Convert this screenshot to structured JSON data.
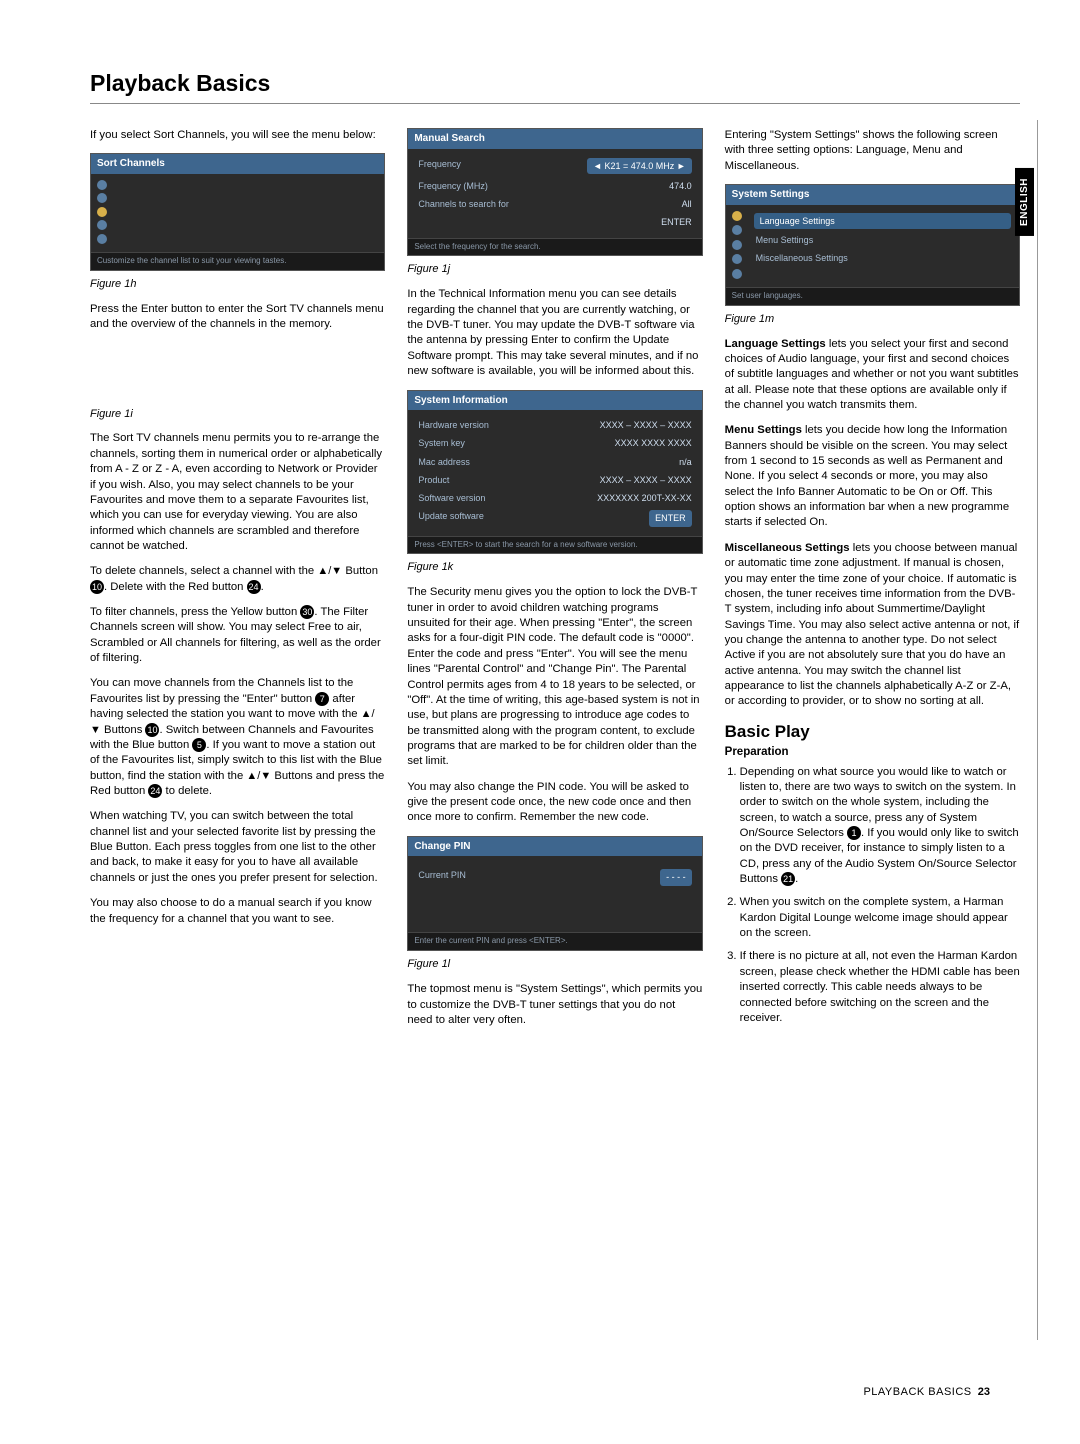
{
  "page": {
    "title": "Playback Basics",
    "english_tab": "ENGLISH",
    "footer_label": "PLAYBACK BASICS",
    "footer_page": "23"
  },
  "col1": {
    "intro": "If you select Sort Channels, you will see the menu below:",
    "shot_sort": {
      "hdr": "Sort Channels",
      "tip": "Customize the channel list to suit your viewing tastes."
    },
    "fig1h": "Figure 1h",
    "p_after_1h": "Press the Enter button to enter the Sort TV channels menu and the overview of the channels in the memory.",
    "fig1i": "Figure 1i",
    "p1i_1": "The Sort TV channels menu permits you to re-arrange the channels, sorting them in numerical order or alphabetically from A - Z or Z - A, even according to Network or Provider if you wish. Also, you may select channels to be your Favourites and move them to a separate Favourites list, which you can use for everyday viewing. You are also informed which channels are scrambled and therefore cannot be watched.",
    "p1i_2a": "To delete channels, select a channel with the ",
    "p1i_2b": "Button ",
    "p1i_2c": ". Delete with the Red button ",
    "p1i_2d": ".",
    "p1i_3a": "To filter channels, press the Yellow button ",
    "p1i_3b": ". The Filter Channels screen will show. You may select Free to air, Scrambled or All channels for filtering, as well as the order of filtering.",
    "p1i_4a": "You can move channels from the Channels list to the Favourites list by pressing the \"Enter\" button ",
    "p1i_4b": " after having selected the station you want to move with the ",
    "p1i_4c": " Buttons ",
    "p1i_4d": ". Switch between Channels and Favourites with the Blue button ",
    "p1i_4e": ". If you want to move a station out of the Favourites list, simply switch to this list with the Blue button, find the station with the ",
    "p1i_4f": " Buttons and press the Red button ",
    "p1i_4g": " to delete.",
    "p1i_5": "When watching TV, you can switch between the total channel list and your selected favorite list by pressing the Blue Button. Each press toggles from one list to the other and back, to make it easy for you to have all available channels or just the ones you prefer present for selection.",
    "p1i_6": "You may also choose to do a manual search if you know the frequency for a channel that you want to see.",
    "callouts": {
      "c10": "10",
      "c24": "24",
      "c30": "30",
      "c7": "7",
      "c5": "5"
    },
    "arrows": "▲/▼"
  },
  "col2": {
    "shot_manual": {
      "hdr": "Manual Search",
      "r1_l": "Frequency",
      "r1_v": "K21 = 474.0 MHz",
      "r2_l": "Frequency (MHz)",
      "r2_v": "474.0",
      "r3_l": "Channels to search for",
      "r3_v": "All",
      "r4_v": "ENTER",
      "tip": "Select the frequency for the search."
    },
    "fig1j": "Figure 1j",
    "p1j": "In the Technical Information menu you can see details regarding the channel that you are currently watching, or the DVB-T tuner. You may update the DVB-T software via the antenna by pressing Enter to confirm the Update Software prompt. This may take several minutes, and if no new software is available, you will be informed about this.",
    "shot_sys": {
      "hdr": "System Information",
      "r1_l": "Hardware version",
      "r1_v": "XXXX – XXXX – XXXX",
      "r2_l": "System key",
      "r2_v": "XXXX    XXXX  XXXX",
      "r3_l": "Mac address",
      "r3_v": "n/a",
      "r4_l": "Product",
      "r4_v": "XXXX – XXXX – XXXX",
      "r5_l": "Software version",
      "r5_v": "XXXXXXX 200T-XX-XX",
      "r6_l": "Update software",
      "r6_v": "ENTER",
      "tip": "Press <ENTER> to start the search for a new software version."
    },
    "fig1k": "Figure 1k",
    "p1k": "The Security menu gives you the option to lock the DVB-T tuner in order to avoid children watching programs unsuited for their age. When pressing \"Enter\", the screen asks for a four-digit PIN code. The default code is \"0000\". Enter the code and press \"Enter\". You will see the menu lines \"Parental Control\" and \"Change Pin\". The Parental Control permits ages from 4 to 18 years to be selected, or \"Off\". At the time of writing, this age-based system is not in use, but plans are progressing to introduce age codes to be transmitted along with the program content, to exclude programs that are marked to be for children older than the set limit.",
    "p1k2": "You may also change the PIN code. You will be asked to give the present code once, the new code once and then once more to confirm. Remember the new code.",
    "shot_pin": {
      "hdr": "Change PIN",
      "label": "Current PIN",
      "val": "- - - -",
      "tip": "Enter the current PIN and press <ENTER>."
    },
    "fig1l": "Figure 1l",
    "p1l": "The topmost menu is \"System Settings\", which permits you to customize the DVB-T tuner settings that you do not need to alter very often."
  },
  "col3": {
    "p_top": "Entering \"System Settings\" shows the following screen with three setting options: Language, Menu and Miscellaneous.",
    "shot_settings": {
      "hdr": "System Settings",
      "i1": "Language Settings",
      "i2": "Menu Settings",
      "i3": "Miscellaneous Settings",
      "tip": "Set user languages."
    },
    "fig1m": "Figure 1m",
    "lang_lead": "Language Settings",
    "lang_body": " lets you select your first and second choices of Audio language, your first and second choices of subtitle languages and whether or not you want subtitles at all. Please note that these options are available only if the channel you watch transmits them.",
    "menu_lead": "Menu Settings",
    "menu_body": " lets you decide how long the Information Banners should be visible on the screen. You may select from 1 second to 15 seconds as well as Permanent and None. If you select 4 seconds or more, you may also select the Info Banner Automatic to be On or Off. This option shows an information bar when a new programme starts if selected On.",
    "misc_lead": "Miscellaneous Settings",
    "misc_body": " lets you choose between manual or automatic time zone adjustment. If manual is chosen, you may enter the time zone of your choice. If automatic is chosen, the tuner receives time information from the DVB-T system, including info about Summertime/Daylight Savings Time. You may also select active antenna or not, if you change the antenna to another type. Do not select Active if you are not absolutely sure that you do have an active antenna. You may switch the channel list appearance to list the channels alphabetically A-Z or Z-A, or according to provider, or to show no sorting at all.",
    "basic_play": "Basic Play",
    "prep": "Preparation",
    "li1a": "Depending on what source you would like to watch or listen to, there are two ways to switch on the system. In order to switch on the whole system, including the screen, to watch a source, press any of System On/Source Selectors ",
    "li1b": ". If you would only like to switch on the DVD receiver, for instance to simply listen to a CD, press any of the Audio System On/Source Selector Buttons ",
    "li1c": ".",
    "li2": "When you switch on the complete system, a Harman Kardon Digital Lounge welcome image should appear on the screen.",
    "li3": "If there is no picture at all, not even the Harman Kardon screen, please check whether the HDMI cable has been inserted correctly. This cable needs always to be connected before switching on the screen and the receiver.",
    "c1": "1",
    "c21": "21"
  }
}
